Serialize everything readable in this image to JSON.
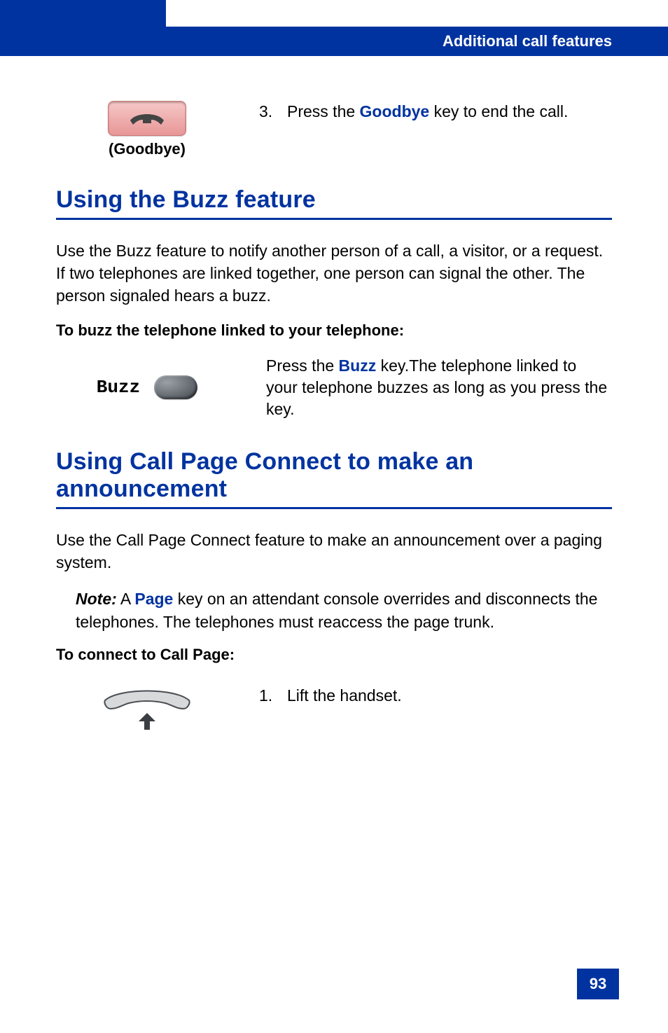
{
  "header": {
    "title": "Additional call features"
  },
  "step3": {
    "number": "3.",
    "pre": "Press the ",
    "key": "Goodbye",
    "post": " key to end the call.",
    "button_label": "(Goodbye)"
  },
  "buzz": {
    "heading": "Using the Buzz feature",
    "intro": "Use the Buzz feature to notify another person of a call, a visitor, or a request. If two telephones are linked together, one person can signal the other. The person signaled hears a buzz.",
    "how_heading": "To buzz the telephone linked to your telephone:",
    "label": "Buzz",
    "text_pre": "Press the ",
    "text_key": "Buzz",
    "text_post": " key.The telephone linked to your telephone buzzes as long as you press the key."
  },
  "callpage": {
    "heading": "Using Call Page Connect to make an announcement",
    "intro": "Use the Call Page Connect feature to make an announcement over a paging system.",
    "note_label": "Note:",
    "note_pre": " A ",
    "note_key": "Page",
    "note_post": " key on an attendant console overrides and disconnects the telephones. The telephones must reaccess the page trunk.",
    "connect_heading": "To connect to Call Page:",
    "step1_num": "1.",
    "step1_text": "Lift the handset."
  },
  "page_number": "93"
}
